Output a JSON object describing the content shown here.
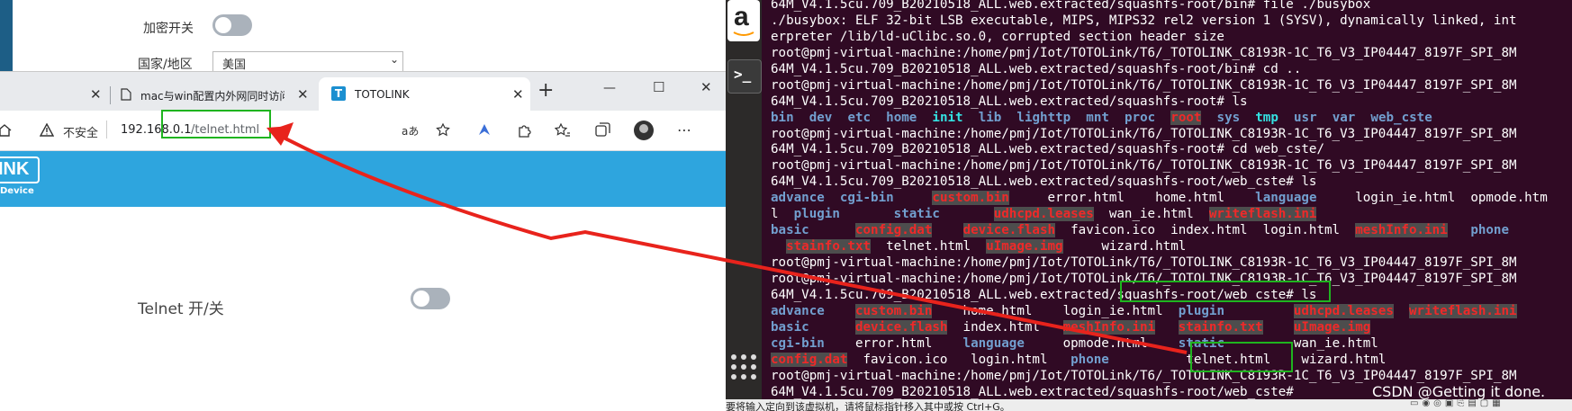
{
  "background_window": {
    "encrypt_label": "加密开关",
    "region_label": "国家/地区",
    "region_value": "美国"
  },
  "browser": {
    "tabs": [
      {
        "title": "",
        "active": false
      },
      {
        "title": "mac与win配置内外网同时访问",
        "active": false
      },
      {
        "title": "TOTOLINK",
        "active": true
      }
    ],
    "new_tab_glyph": "+",
    "window_controls": {
      "minimize": "—",
      "maximize": "☐",
      "close": "✕"
    },
    "address": {
      "security_label": "不安全",
      "url_host": "192.168.0.1",
      "url_path": "/telnet.html",
      "read_aloud": "aあ"
    },
    "banner": {
      "logo_text": "INK",
      "logo_sub": "Device"
    },
    "page": {
      "telnet_label": "Telnet 开/关"
    }
  },
  "terminal": {
    "lines": [
      [
        {
          "t": "64M_V4.1.5cu.709_B20210518_ALL.web.extracted/squashfs-root/bin# file ./busybox"
        }
      ],
      [
        {
          "t": "./busybox: ELF 32-bit LSB executable, MIPS, MIPS32 rel2 version 1 (SYSV), dynamically linked, int"
        }
      ],
      [
        {
          "t": "erpreter /lib/ld-uClibc.so.0, corrupted section header size"
        }
      ],
      [
        {
          "t": "root@pmj-virtual-machine:/home/pmj/Iot/TOTOLink/T6/_TOTOLINK_C8193R-1C_T6_V3_IP04447_8197F_SPI_8M"
        }
      ],
      [
        {
          "t": "64M_V4.1.5cu.709_B20210518_ALL.web.extracted/squashfs-root/bin# cd .."
        }
      ],
      [
        {
          "t": "root@pmj-virtual-machine:/home/pmj/Iot/TOTOLink/T6/_TOTOLINK_C8193R-1C_T6_V3_IP04447_8197F_SPI_8M"
        }
      ],
      [
        {
          "t": "64M_V4.1.5cu.709_B20210518_ALL.web.extracted/squashfs-root# ls"
        }
      ],
      [
        {
          "t": "bin",
          "c": "bluebold"
        },
        {
          "t": "  "
        },
        {
          "t": "dev",
          "c": "bluebold"
        },
        {
          "t": "  "
        },
        {
          "t": "etc",
          "c": "bluebold"
        },
        {
          "t": "  "
        },
        {
          "t": "home",
          "c": "bluebold"
        },
        {
          "t": "  "
        },
        {
          "t": "init",
          "c": "cyanbold"
        },
        {
          "t": "  "
        },
        {
          "t": "lib",
          "c": "bluebold"
        },
        {
          "t": "  "
        },
        {
          "t": "lighttp",
          "c": "bluebold"
        },
        {
          "t": "  "
        },
        {
          "t": "mnt",
          "c": "bluebold"
        },
        {
          "t": "  "
        },
        {
          "t": "proc",
          "c": "bluebold"
        },
        {
          "t": "  "
        },
        {
          "t": "root",
          "c": "redhl"
        },
        {
          "t": "  "
        },
        {
          "t": "sys",
          "c": "bluebold"
        },
        {
          "t": "  "
        },
        {
          "t": "tmp",
          "c": "cyanbold"
        },
        {
          "t": "  "
        },
        {
          "t": "usr",
          "c": "bluebold"
        },
        {
          "t": "  "
        },
        {
          "t": "var",
          "c": "bluebold"
        },
        {
          "t": "  "
        },
        {
          "t": "web_cste",
          "c": "bluebold"
        }
      ],
      [
        {
          "t": "root@pmj-virtual-machine:/home/pmj/Iot/TOTOLink/T6/_TOTOLINK_C8193R-1C_T6_V3_IP04447_8197F_SPI_8M"
        }
      ],
      [
        {
          "t": "64M_V4.1.5cu.709_B20210518_ALL.web.extracted/squashfs-root# cd web_cste/"
        }
      ],
      [
        {
          "t": "root@pmj-virtual-machine:/home/pmj/Iot/TOTOLink/T6/_TOTOLINK_C8193R-1C_T6_V3_IP04447_8197F_SPI_8M"
        }
      ],
      [
        {
          "t": "64M_V4.1.5cu.709_B20210518_ALL.web.extracted/squashfs-root/web_cste# ls"
        }
      ],
      [
        {
          "t": "advance",
          "c": "bluebold"
        },
        {
          "t": "  "
        },
        {
          "t": "cgi-bin",
          "c": "bluebold"
        },
        {
          "t": "     "
        },
        {
          "t": "custom.bin",
          "c": "redhl"
        },
        {
          "t": "     error.html    home.html    "
        },
        {
          "t": "language",
          "c": "bluebold"
        },
        {
          "t": "     login_ie.html  opmode.htm"
        }
      ],
      [
        {
          "t": "l  "
        },
        {
          "t": "plugin",
          "c": "bluebold"
        },
        {
          "t": "       "
        },
        {
          "t": "static",
          "c": "bluebold"
        },
        {
          "t": "       "
        },
        {
          "t": "udhcpd.leases",
          "c": "redhl"
        },
        {
          "t": "  wan_ie.html  "
        },
        {
          "t": "writeflash.ini",
          "c": "redhl"
        }
      ],
      [
        {
          "t": "basic",
          "c": "bluebold"
        },
        {
          "t": "      "
        },
        {
          "t": "config.dat",
          "c": "redhl"
        },
        {
          "t": "    "
        },
        {
          "t": "device.flash",
          "c": "redhl"
        },
        {
          "t": "  favicon.ico  index.html  login.html  "
        },
        {
          "t": "meshInfo.ini",
          "c": "redhl"
        },
        {
          "t": "   "
        },
        {
          "t": "phone",
          "c": "bluebold"
        }
      ],
      [
        {
          "t": "  "
        },
        {
          "t": "stainfo.txt",
          "c": "redhl"
        },
        {
          "t": "  telnet.html  "
        },
        {
          "t": "uImage.img",
          "c": "redhl"
        },
        {
          "t": "     wizard.html"
        }
      ],
      [
        {
          "t": "root@pmj-virtual-machine:/home/pmj/Iot/TOTOLink/T6/_TOTOLINK_C8193R-1C_T6_V3_IP04447_8197F_SPI_8M"
        }
      ],
      [
        {
          "t": "root@pmj-virtual-machine:/home/pmj/Iot/TOTOLink/T6/_TOTOLINK_C8193R-1C_T6_V3_IP04447_8197F_SPI_8M"
        }
      ],
      [
        {
          "t": "64M_V4.1.5cu.709_B20210518_ALL.web.extracted/squashfs-root/web_cste# ls"
        }
      ],
      [
        {
          "t": "advance",
          "c": "bluebold"
        },
        {
          "t": "    "
        },
        {
          "t": "custom.bin",
          "c": "redhl"
        },
        {
          "t": "    home.html    login_ie.html  "
        },
        {
          "t": "plugin",
          "c": "bluebold"
        },
        {
          "t": "         "
        },
        {
          "t": "udhcpd.leases",
          "c": "redhl"
        },
        {
          "t": "  "
        },
        {
          "t": "writeflash.ini",
          "c": "redhl"
        }
      ],
      [
        {
          "t": "basic",
          "c": "bluebold"
        },
        {
          "t": "      "
        },
        {
          "t": "device.flash",
          "c": "redhl"
        },
        {
          "t": "  index.html   "
        },
        {
          "t": "meshInfo.ini",
          "c": "redhl"
        },
        {
          "t": "   "
        },
        {
          "t": "stainfo.txt",
          "c": "redhl"
        },
        {
          "t": "    "
        },
        {
          "t": "uImage.img",
          "c": "redhl"
        }
      ],
      [
        {
          "t": "cgi-bin",
          "c": "bluebold"
        },
        {
          "t": "    error.html    "
        },
        {
          "t": "language",
          "c": "bluebold"
        },
        {
          "t": "     opmode.html    "
        },
        {
          "t": "static",
          "c": "bluebold"
        },
        {
          "t": "         wan_ie.html"
        }
      ],
      [
        {
          "t": "config.dat",
          "c": "redhl"
        },
        {
          "t": "  favicon.ico   login.html   "
        },
        {
          "t": "phone",
          "c": "bluebold"
        },
        {
          "t": "          telnet.html    wizard.html"
        }
      ],
      [
        {
          "t": "root@pmj-virtual-machine:/home/pmj/Iot/TOTOLink/T6/_TOTOLINK_C8193R-1C_T6_V3_IP04447_8197F_SPI_8M"
        }
      ],
      [
        {
          "t": "64M_V4.1.5cu.709_B20210518_ALL.web.extracted/squashfs-root/web_cste# "
        }
      ]
    ]
  },
  "statusbar_text": "要将输入定向到该虚拟机，请将鼠标指针移入其中或按 Ctrl+G。",
  "watermark": "CSDN @Getting it done.",
  "colors": {
    "accent_green": "#1fb41f",
    "arrow_red": "#e8231c",
    "banner_blue": "#2ea5de",
    "terminal_bg": "#300a24"
  }
}
